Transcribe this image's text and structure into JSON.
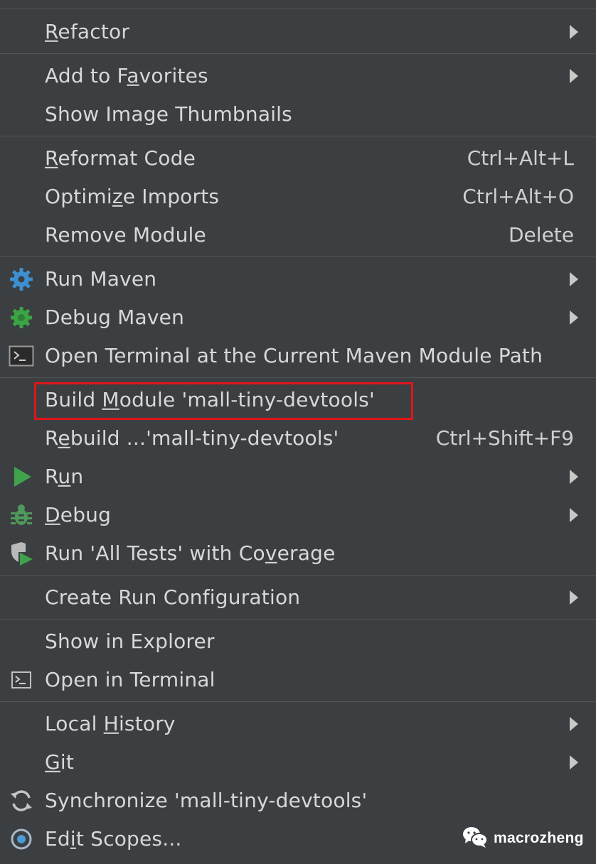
{
  "menu": {
    "items": {
      "refactor": {
        "pre": "",
        "u": "R",
        "post": "efactor"
      },
      "add_to_favorites": {
        "pre": "Add to F",
        "u": "a",
        "post": "vorites"
      },
      "show_image_thumbnails": {
        "pre": "Show Image Thumbnails",
        "u": "",
        "post": ""
      },
      "reformat_code": {
        "pre": "",
        "u": "R",
        "post": "eformat Code",
        "shortcut": "Ctrl+Alt+L"
      },
      "optimize_imports": {
        "pre": "Optimi",
        "u": "z",
        "post": "e Imports",
        "shortcut": "Ctrl+Alt+O"
      },
      "remove_module": {
        "pre": "Remove Module",
        "u": "",
        "post": "",
        "shortcut": "Delete"
      },
      "run_maven": {
        "pre": "Run Maven",
        "u": "",
        "post": ""
      },
      "debug_maven": {
        "pre": "Debug Maven",
        "u": "",
        "post": ""
      },
      "open_terminal_maven": {
        "pre": "Open Terminal at the Current Maven Module Path",
        "u": "",
        "post": ""
      },
      "build_module": {
        "pre": "Build ",
        "u": "M",
        "post": "odule 'mall-tiny-devtools'"
      },
      "rebuild": {
        "pre": "R",
        "u": "e",
        "post": "build ...'mall-tiny-devtools'",
        "shortcut": "Ctrl+Shift+F9"
      },
      "run": {
        "pre": "R",
        "u": "u",
        "post": "n"
      },
      "debug": {
        "pre": "",
        "u": "D",
        "post": "ebug"
      },
      "run_all_tests_coverage": {
        "pre": "Run 'All Tests' with Co",
        "u": "v",
        "post": "erage"
      },
      "create_run_configuration": {
        "pre": "Create Run Configuration",
        "u": "",
        "post": ""
      },
      "show_in_explorer": {
        "pre": "Show in Explorer",
        "u": "",
        "post": ""
      },
      "open_in_terminal": {
        "pre": "Open in Terminal",
        "u": "",
        "post": ""
      },
      "local_history": {
        "pre": "Local ",
        "u": "H",
        "post": "istory"
      },
      "git": {
        "pre": "",
        "u": "G",
        "post": "it"
      },
      "synchronize": {
        "pre": "Synchronize 'mall-tiny-devtools'",
        "u": "",
        "post": ""
      },
      "edit_scopes": {
        "pre": "Ed",
        "u": "i",
        "post": "t Scopes..."
      }
    },
    "icons": {
      "run_maven": "gear-icon",
      "debug_maven": "debug-gear-icon",
      "open_terminal_maven": "terminal-icon",
      "run": "run-triangle-icon",
      "debug": "bug-icon",
      "run_all_tests_coverage": "coverage-shield-icon",
      "open_in_terminal": "terminal-icon",
      "synchronize": "sync-icon",
      "edit_scopes": "scope-target-icon"
    },
    "highlighted_item": "build_module"
  },
  "watermark": {
    "icon": "wechat-icon",
    "text": "macrozheng"
  },
  "colors": {
    "background": "#3c3f41",
    "text": "#d8d8d8",
    "separator": "#515455",
    "highlight_border": "#e0161b",
    "gear_blue": "#3d8fd1",
    "run_green": "#3fa34d",
    "bug_green": "#4f9a5a",
    "debug_maven_green": "#3aa545"
  }
}
